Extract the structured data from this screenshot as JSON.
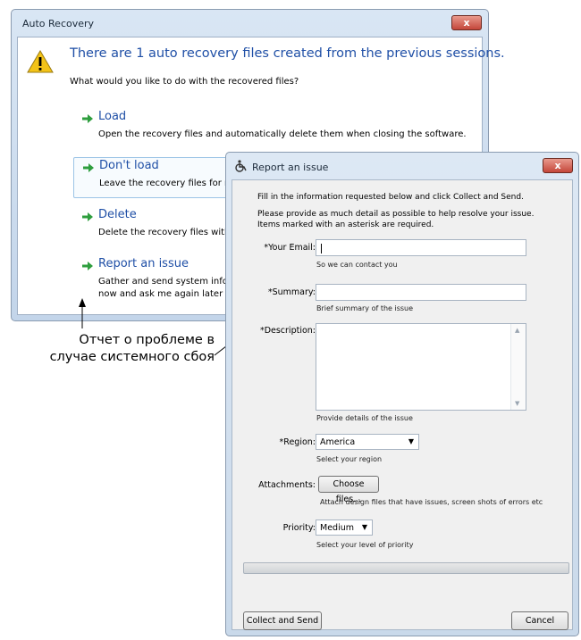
{
  "auto_recovery": {
    "title": "Auto Recovery",
    "close_label": "x",
    "heading": "There are 1 auto recovery files created from the  previous sessions.",
    "question": "What would you like to do with the recovered files?",
    "options": [
      {
        "title": "Load",
        "desc_lines": [
          "Open the recovery files and automatically delete them when closing the software."
        ]
      },
      {
        "title": "Don't load",
        "desc_lines": [
          "Leave the recovery files for no"
        ]
      },
      {
        "title": "Delete",
        "desc_lines": [
          "Delete the recovery files witho"
        ]
      },
      {
        "title": "Report an issue",
        "desc_lines": [
          "Gather and send system infor",
          "now and ask me again later w"
        ]
      }
    ]
  },
  "annotation": {
    "lines": [
      "Отчет о проблеме в",
      "случае системного сбоя"
    ]
  },
  "report_issue": {
    "title": "Report an issue",
    "close_label": "x",
    "intro": [
      "Fill in the information requested below and click Collect and Send.",
      "Please provide as much detail as possible to help resolve your issue.",
      "Items marked with an asterisk are required."
    ],
    "email": {
      "label": "*Your Email:",
      "value": "",
      "hint": "So we can contact you"
    },
    "summary": {
      "label": "*Summary:",
      "value": "",
      "hint": "Brief summary of the issue"
    },
    "description": {
      "label": "*Description:",
      "value": "",
      "hint": "Provide details of the issue"
    },
    "region": {
      "label": "*Region:",
      "value": "America",
      "hint": "Select your region"
    },
    "attachments": {
      "label": "Attachments:",
      "button": "Choose files...",
      "hint": "Attach design files that have issues, screen shots of errors etc"
    },
    "priority": {
      "label": "Priority:",
      "value": "Medium",
      "hint": "Select your level of priority"
    },
    "progress": 0.0,
    "collect_button": "Collect and Send",
    "cancel_button": "Cancel"
  },
  "colors": {
    "link_blue": "#1f4fa6",
    "arrow_green": "#2e9e3e",
    "close_red": "#c4463a"
  }
}
